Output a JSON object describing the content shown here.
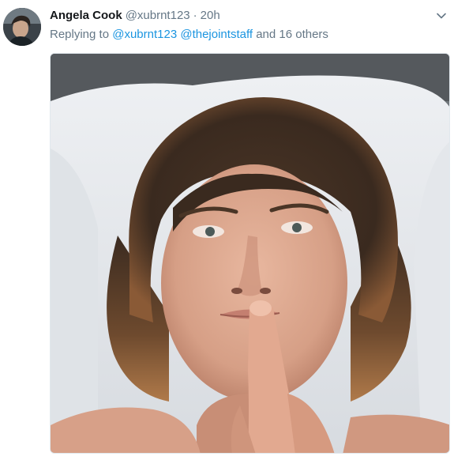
{
  "tweet": {
    "author_name": "Angela Cook",
    "author_handle": "@xubrnt123",
    "separator": "·",
    "timestamp": "20h",
    "replying_prefix": "Replying to",
    "reply_mentions": [
      "@xubrnt123",
      "@thejointstaff"
    ],
    "reply_suffix": "and 16 others",
    "avatar_icon": "profile-photo",
    "menu_icon": "chevron-down-icon",
    "media_type": "photo"
  },
  "colors": {
    "name": "#14171a",
    "secondary": "#657786",
    "link": "#1b95e0",
    "border": "#e1e8ed"
  }
}
